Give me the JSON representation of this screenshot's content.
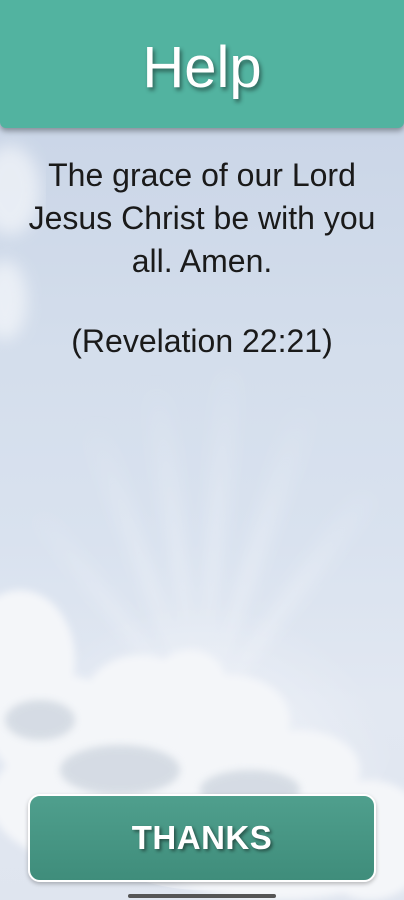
{
  "header": {
    "title": "Help"
  },
  "content": {
    "verse": "The grace of our Lord Jesus Christ be with you all. Amen.",
    "reference": "(Revelation 22:21)"
  },
  "actions": {
    "thanks_label": "THANKS"
  },
  "colors": {
    "header_background": "#52b3a0",
    "button_background": "#3f8d7b",
    "sky_background": "#d4deec"
  }
}
